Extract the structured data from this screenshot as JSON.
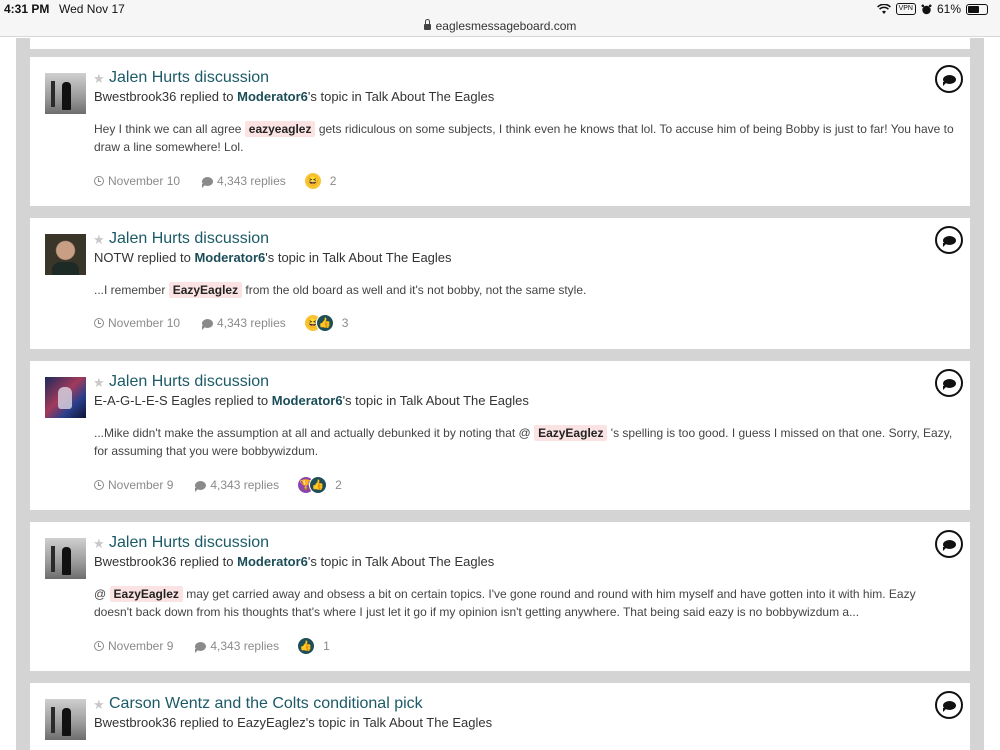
{
  "status_bar": {
    "time": "4:31 PM",
    "date": "Wed Nov 17",
    "vpn": "VPN",
    "battery": "61%",
    "battery_level": 0.61
  },
  "browser": {
    "url": "eaglesmessageboard.com"
  },
  "posts": [
    {
      "title": "Jalen Hurts discussion",
      "author": "Bwestbrook36",
      "replied_to_text": "replied to",
      "topic_owner": "Moderator6",
      "topic_suffix": "'s topic in Talk About The Eagles",
      "body_before": "Hey I think we can all agree",
      "mention": "eazyeaglez",
      "body_after": "gets ridiculous on some subjects, I think even he knows that lol. To accuse him of being Bobby is just to far! You have to draw a line somewhere! Lol.",
      "date": "November 10",
      "replies": "4,343 replies",
      "reaction_icons": [
        "haha-reaction-icon"
      ],
      "reaction_count": "2"
    },
    {
      "title": "Jalen Hurts discussion",
      "author": "NOTW",
      "replied_to_text": "replied to",
      "topic_owner": "Moderator6",
      "topic_suffix": "'s topic in Talk About The Eagles",
      "body_before": "...I remember",
      "mention": "EazyEaglez",
      "body_after": "from the old board as well and it's not bobby, not the same style.",
      "date": "November 10",
      "replies": "4,343 replies",
      "reaction_icons": [
        "haha-reaction-icon",
        "like-reaction-icon"
      ],
      "reaction_count": "3"
    },
    {
      "title": "Jalen Hurts discussion",
      "author": "E-A-G-L-E-S Eagles",
      "replied_to_text": "replied to",
      "topic_owner": "Moderator6",
      "topic_suffix": "'s topic in Talk About The Eagles",
      "body_before": "...Mike didn't make the assumption at all and actually debunked it by noting that @",
      "mention": "EazyEaglez",
      "body_after": "'s spelling is too good. I guess I missed on that one. Sorry, Eazy, for assuming that you were bobbywizdum.",
      "date": "November 9",
      "replies": "4,343 replies",
      "reaction_icons": [
        "trophy-reaction-icon",
        "like-reaction-icon"
      ],
      "reaction_count": "2"
    },
    {
      "title": "Jalen Hurts discussion",
      "author": "Bwestbrook36",
      "replied_to_text": "replied to",
      "topic_owner": "Moderator6",
      "topic_suffix": "'s topic in Talk About The Eagles",
      "body_before": "@",
      "mention": "EazyEaglez",
      "body_after": "may get carried away and obsess a bit on certain topics. I've gone round and round with him myself and have gotten into it with him. Eazy doesn't back down from his thoughts that's where I just let it go if my opinion isn't getting anywhere. That being said eazy is no bobbywizdum a...",
      "date": "November 9",
      "replies": "4,343 replies",
      "reaction_icons": [
        "like-reaction-icon"
      ],
      "reaction_count": "1"
    },
    {
      "title": "Carson Wentz and the Colts conditional pick",
      "author": "Bwestbrook36",
      "replied_to_text": "replied to",
      "topic_owner": "EazyEaglez",
      "topic_suffix": "'s topic in Talk About The Eagles"
    }
  ]
}
